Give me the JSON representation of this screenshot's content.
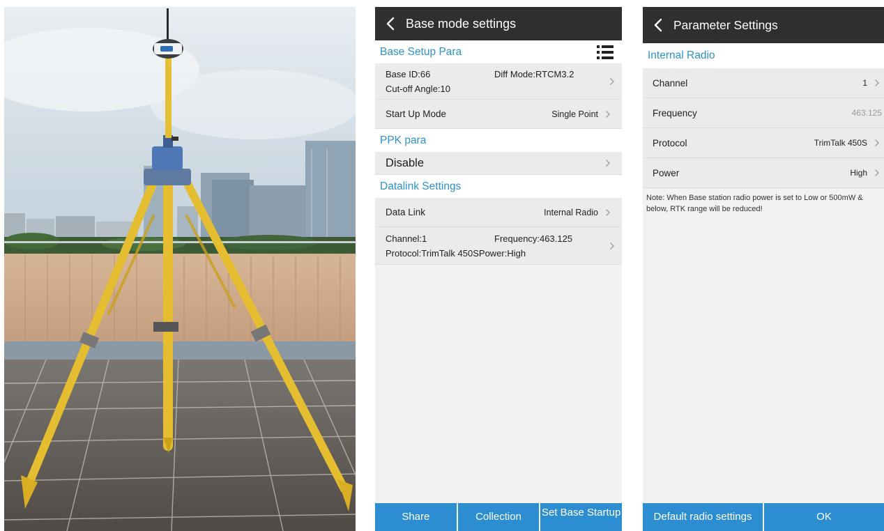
{
  "photo": {
    "subject": "gnss-receiver-on-tripod-rooftop"
  },
  "base_mode": {
    "title": "Base mode settings",
    "sections": {
      "setup": "Base Setup Para",
      "ppk": "PPK para",
      "datalink": "Datalink Settings"
    },
    "base_row": {
      "base_id": "Base ID:66",
      "diff_mode": "Diff Mode:RTCM3.2",
      "cutoff": "Cut-off Angle:10"
    },
    "startup": {
      "label": "Start Up Mode",
      "value": "Single Point"
    },
    "ppk": {
      "label": "Disable"
    },
    "datalink_row": {
      "label": "Data Link",
      "value": "Internal Radio"
    },
    "radio_row": {
      "channel": "Channel:1",
      "frequency": "Frequency:463.125",
      "protocol": "Protocol:TrimTalk 450S",
      "power": "Power:High"
    },
    "buttons": {
      "share": "Share",
      "collection": "Collection",
      "set_base": "Set Base Startup"
    }
  },
  "parameter": {
    "title": "Parameter Settings",
    "section": "Internal Radio",
    "rows": [
      {
        "label": "Channel",
        "value": "1"
      },
      {
        "label": "Frequency",
        "value": "463.125"
      },
      {
        "label": "Protocol",
        "value": "TrimTalk 450S"
      },
      {
        "label": "Power",
        "value": "High"
      }
    ],
    "note": "Note: When Base station radio power is set to Low or 500mW & below, RTK range will be reduced!",
    "buttons": {
      "default": "Default radio settings",
      "ok": "OK"
    }
  },
  "colors": {
    "appbar": "#2f2f2f",
    "accent": "#2c92c8",
    "button": "#2c8ed0",
    "row_bg": "#ebebeb"
  }
}
